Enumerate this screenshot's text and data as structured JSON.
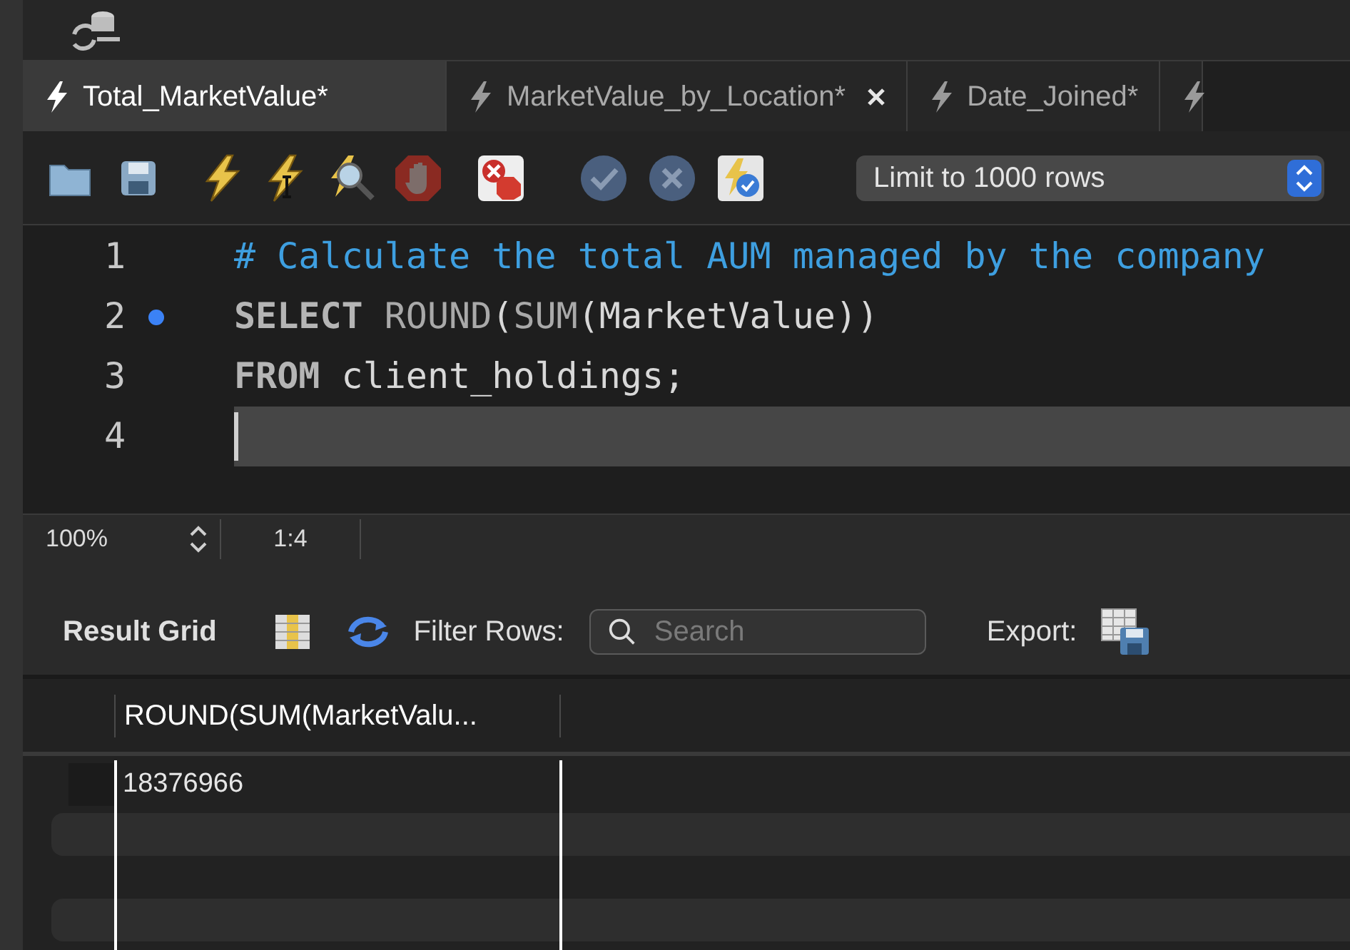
{
  "tabs": [
    {
      "label": "Total_MarketValue*",
      "selected": true,
      "close_button": false
    },
    {
      "label": "MarketValue_by_Location*",
      "selected": false,
      "close_button": true
    },
    {
      "label": "Date_Joined*",
      "selected": false,
      "close_button": false
    },
    {
      "selected": false,
      "close_button": false
    }
  ],
  "limit_select": {
    "value": "Limit to 1000 rows"
  },
  "editor": {
    "lines": [
      {
        "number": "1",
        "marker": false,
        "current": false,
        "tokens": [
          {
            "text": "# Calculate the total AUM managed by the company",
            "kind": "comment"
          }
        ]
      },
      {
        "number": "2",
        "marker": true,
        "current": false,
        "tokens": [
          {
            "text": "SELECT ",
            "kind": "keyword"
          },
          {
            "text": "ROUND",
            "kind": "function"
          },
          {
            "text": "(",
            "kind": "plain"
          },
          {
            "text": "SUM",
            "kind": "function"
          },
          {
            "text": "(MarketValue))",
            "kind": "plain"
          }
        ]
      },
      {
        "number": "3",
        "marker": false,
        "current": false,
        "tokens": [
          {
            "text": "FROM",
            "kind": "keyword"
          },
          {
            "text": " client_holdings;",
            "kind": "plain"
          }
        ]
      },
      {
        "number": "4",
        "marker": false,
        "current": true
      }
    ]
  },
  "status_bar": {
    "zoom": "100%",
    "position": "1:4"
  },
  "result_toolbar": {
    "title": "Result Grid",
    "filter_label": "Filter Rows:",
    "search_placeholder": "Search",
    "export_label": "Export:"
  },
  "grid": {
    "columns": [
      "ROUND(SUM(MarketValu..."
    ],
    "rows": [
      [
        "18376966"
      ]
    ]
  }
}
